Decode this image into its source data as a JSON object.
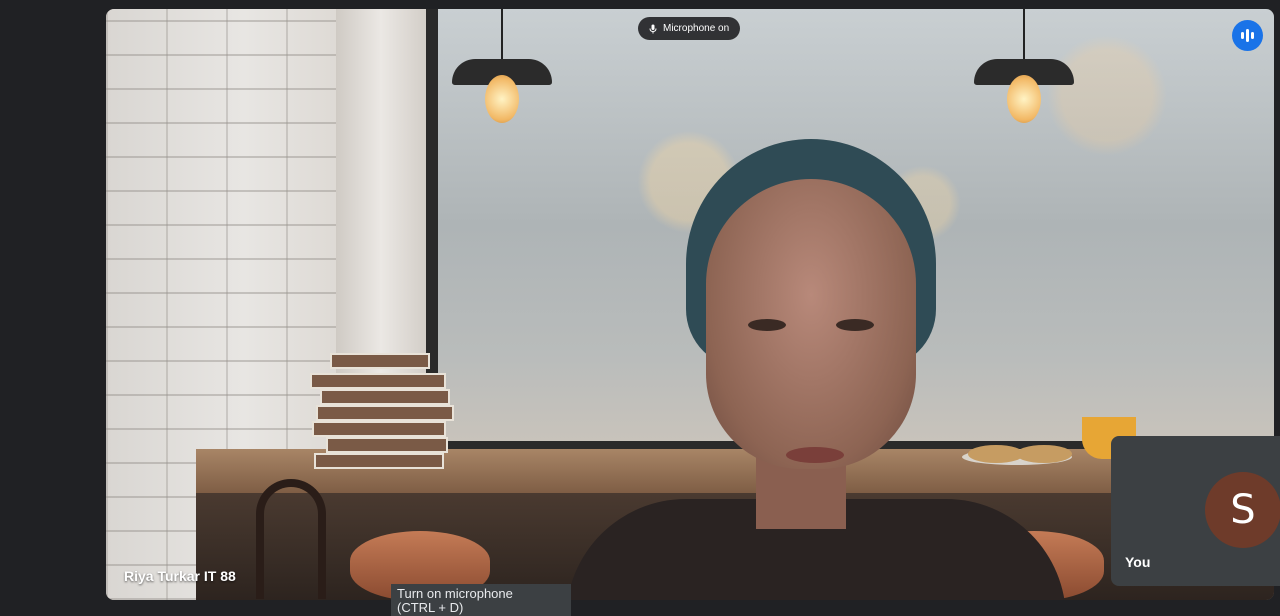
{
  "status": {
    "mic_label": "Microphone on",
    "mic_icon": "microphone-icon"
  },
  "speaking": {
    "icon": "audio-level-icon",
    "color": "#1a73e8"
  },
  "main_participant": {
    "name": "Riya Turkar IT 88"
  },
  "self_view": {
    "label": "You",
    "avatar_letter": "S",
    "avatar_color": "#6e3b2a"
  },
  "tooltip": {
    "line1": "Turn on microphone",
    "line2": "(CTRL + D)"
  }
}
